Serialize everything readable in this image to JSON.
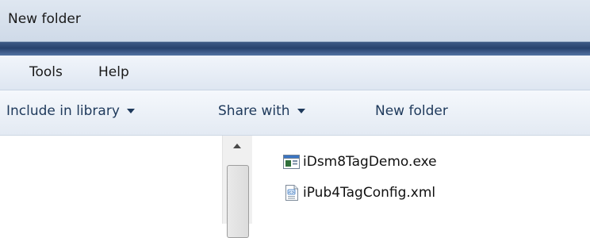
{
  "window": {
    "title": "New folder"
  },
  "menu": {
    "items": [
      "Tools",
      "Help"
    ]
  },
  "toolbar": {
    "include_label": "Include in library",
    "share_label": "Share with",
    "newfolder_label": "New folder"
  },
  "files": [
    {
      "name": "iDsm8TagDemo.exe",
      "icon": "exe-file-icon"
    },
    {
      "name": "iPub4TagConfig.xml",
      "icon": "xml-file-icon"
    }
  ],
  "colors": {
    "accent": "#27426d",
    "command_text": "#1e395b"
  }
}
